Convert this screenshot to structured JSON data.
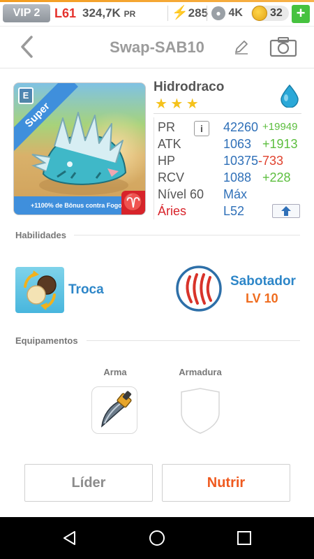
{
  "statusbar": {
    "vip": "VIP 2",
    "level": "L61",
    "pr_value": "324,7K",
    "pr_unit": "PR",
    "energy": "285",
    "paw_count": "4K",
    "coins": "32",
    "add_label": "+"
  },
  "header": {
    "title": "Swap-SAB10"
  },
  "monster": {
    "name": "Hidrodraco",
    "stars": 3,
    "card_tag": "Super",
    "card_badge": "E",
    "card_bonus": "+1100% de Bônus contra Fogo",
    "card_sign_glyph": "♈",
    "element_icon": "water-drop-icon"
  },
  "stats": {
    "pr": {
      "label": "PR",
      "value": "42260",
      "delta": "+19949"
    },
    "info_label": "i",
    "atk": {
      "label": "ATK",
      "value": "1063",
      "delta": "+1913"
    },
    "hp": {
      "label": "HP",
      "value": "10375",
      "delta": "-733"
    },
    "rcv": {
      "label": "RCV",
      "value": "1088",
      "delta": "+228"
    },
    "level": {
      "label": "Nível 60",
      "value": "Máx"
    },
    "sign": {
      "label": "Áries",
      "value": "L52"
    }
  },
  "abilities": {
    "section_title": "Habilidades",
    "skill_name": "Troca",
    "leader_name": "Sabotador",
    "leader_level": "LV 10"
  },
  "equipment": {
    "section_title": "Equipamentos",
    "weapon_label": "Arma",
    "armor_label": "Armadura"
  },
  "actions": {
    "leader_label": "Líder",
    "feed_label": "Nutrir"
  },
  "colors": {
    "accent_blue": "#2f70b8",
    "positive": "#5cbe3e",
    "negative": "#e0422e",
    "orange": "#ef5a1f",
    "aries_red": "#d8232a"
  }
}
